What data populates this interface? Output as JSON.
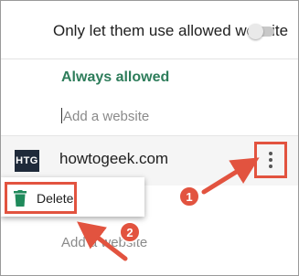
{
  "settings": {
    "toggle_label": "Only let them use allowed website",
    "toggle_on": false
  },
  "always_allowed": {
    "heading": "Always allowed",
    "add_placeholder": "Add a website",
    "sites": [
      {
        "favicon_text": "HTG",
        "domain": "howtogeek.com"
      }
    ]
  },
  "context_menu": {
    "delete_label": "Delete"
  },
  "secondary_add": {
    "placeholder": "Add a website"
  },
  "callouts": {
    "step_1": "1",
    "step_2": "2"
  },
  "colors": {
    "accent_green": "#2e7d5b",
    "highlight_red": "#e2533f",
    "trash_green": "#1f8a5b"
  }
}
